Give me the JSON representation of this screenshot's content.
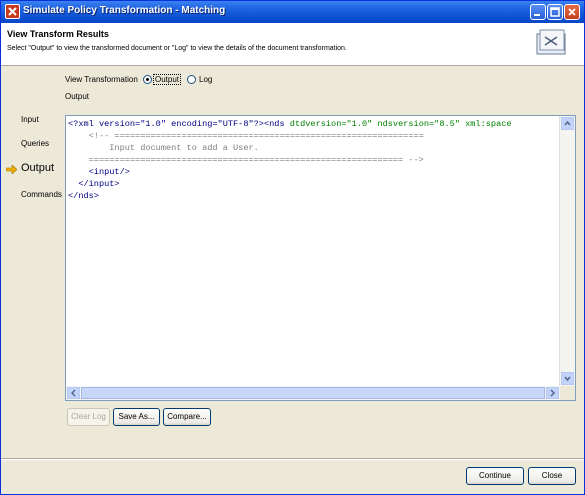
{
  "window": {
    "title": "Simulate Policy Transformation - Matching"
  },
  "header": {
    "title": "View Transform Results",
    "description": "Select \"Output\" to view the transformed document or \"Log\" to view the details of the document transformation."
  },
  "view_transformation": {
    "label": "View Transformation",
    "options": [
      {
        "label": "Output",
        "selected": true
      },
      {
        "label": "Log",
        "selected": false
      }
    ],
    "section_label": "Output"
  },
  "nav": {
    "items": [
      {
        "label": "Input",
        "active": false
      },
      {
        "label": "Queries",
        "active": false
      },
      {
        "label": "Output",
        "active": true
      },
      {
        "label": "Commands",
        "active": false
      }
    ]
  },
  "editor": {
    "line1": {
      "pi": "<?xml version=\"1.0\" encoding=\"UTF-8\"?>",
      "tag_open": "<nds",
      "attrs": " dtdversion=\"1.0\" ndsversion=\"8.5\" xml:space"
    },
    "line2": "    <!-- ============================================================",
    "line3": "        Input document to add a User.",
    "line4": "    ============================================================= -->",
    "line5": "    <input/>",
    "line6": "  </input>",
    "line7": "</nds>"
  },
  "buttons": {
    "clear_log": "Clear Log",
    "save_as": "Save As...",
    "compare": "Compare...",
    "continue": "Continue",
    "close": "Close"
  },
  "colors": {
    "titlebar": "#0a4ed0",
    "tag": "#000080",
    "attribute": "#008000",
    "comment": "#808080",
    "nav_arrow": "#f0b000"
  }
}
